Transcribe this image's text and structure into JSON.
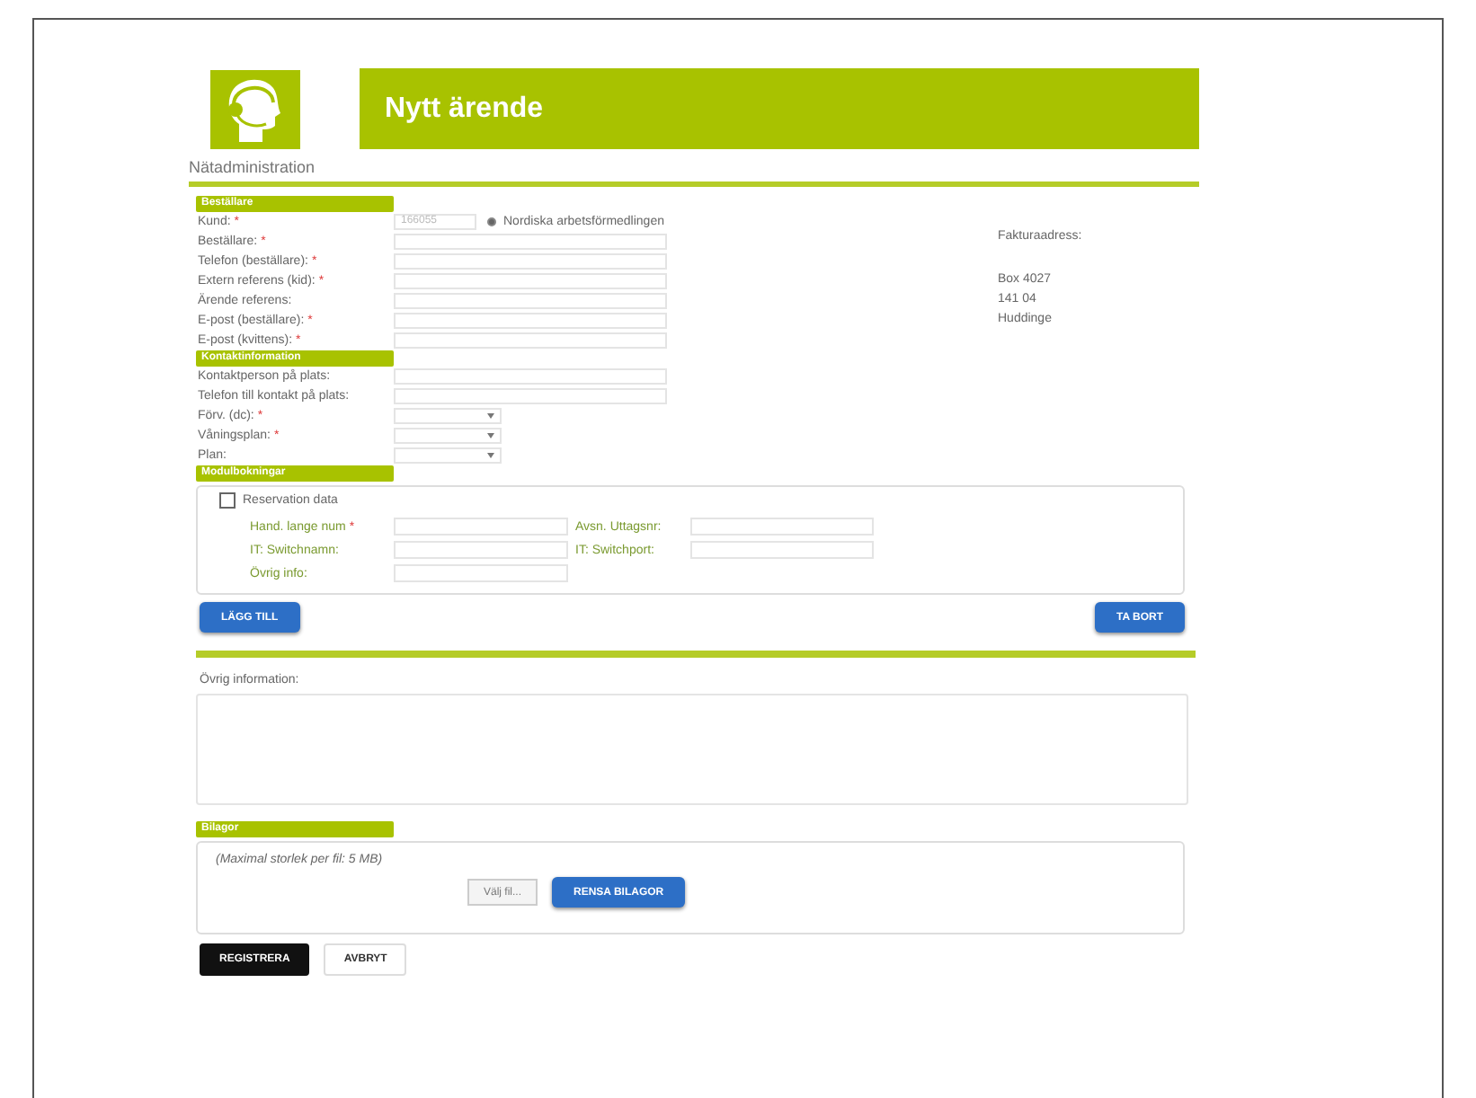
{
  "header": {
    "title": "Nytt ärende",
    "subtitle": "Nätadministration"
  },
  "orderer": {
    "title": "Beställare",
    "customer": {
      "label": "Kund:",
      "mark": "*",
      "number": "166055",
      "selected": true,
      "name": "Nordiska arbetsförmedlingen"
    },
    "fields": [
      {
        "label": "Beställare:",
        "mark": "*"
      },
      {
        "label": "Telefon (beställare):",
        "mark": "*"
      },
      {
        "label": "Extern referens (kid):",
        "mark": "*"
      },
      {
        "label": "Ärende referens:"
      },
      {
        "label": "E-post (beställare):",
        "mark": "*"
      },
      {
        "label": "E-post (kvittens):",
        "mark": "*"
      }
    ],
    "address": {
      "title": "Fakturaadress:",
      "lines": [
        "Box 4027",
        "141 04",
        "Huddinge"
      ]
    }
  },
  "contact": {
    "title": "Kontaktinformation",
    "fields": [
      {
        "label": "Kontaktperson på plats:",
        "kind": "text"
      },
      {
        "label": "Telefon till kontakt på plats:",
        "kind": "text"
      },
      {
        "label": "Förv. (dc):",
        "mark": "*",
        "kind": "select"
      },
      {
        "label": "Våningsplan:",
        "mark": "*",
        "kind": "select"
      },
      {
        "label": "Plan:",
        "kind": "select"
      }
    ]
  },
  "booking": {
    "title": "Modulbokningar",
    "reservation": {
      "label": "Reservation data",
      "checked": false
    },
    "fields": [
      {
        "label": "Hand. lange num",
        "mark": "*"
      },
      {
        "label": "Avsn. Uttagsnr:"
      },
      {
        "label": "IT: Switchnamn:"
      },
      {
        "label": "IT: Switchport:"
      },
      {
        "label": "Övrig info:"
      }
    ],
    "buttons": [
      {
        "label": "LÄGG TILL"
      },
      {
        "label": "TA BORT"
      }
    ]
  },
  "notes": {
    "label": "Övrig information:"
  },
  "attachments": {
    "title": "Bilagor",
    "hint": "(Maximal storlek per fil: 5 MB)",
    "file_button": "Välj fil...",
    "clear_button": "RENSA BILAGOR"
  },
  "actions": [
    {
      "label": "REGISTRERA",
      "kind": "primary"
    },
    {
      "label": "AVBRYT",
      "kind": "secondary"
    }
  ]
}
